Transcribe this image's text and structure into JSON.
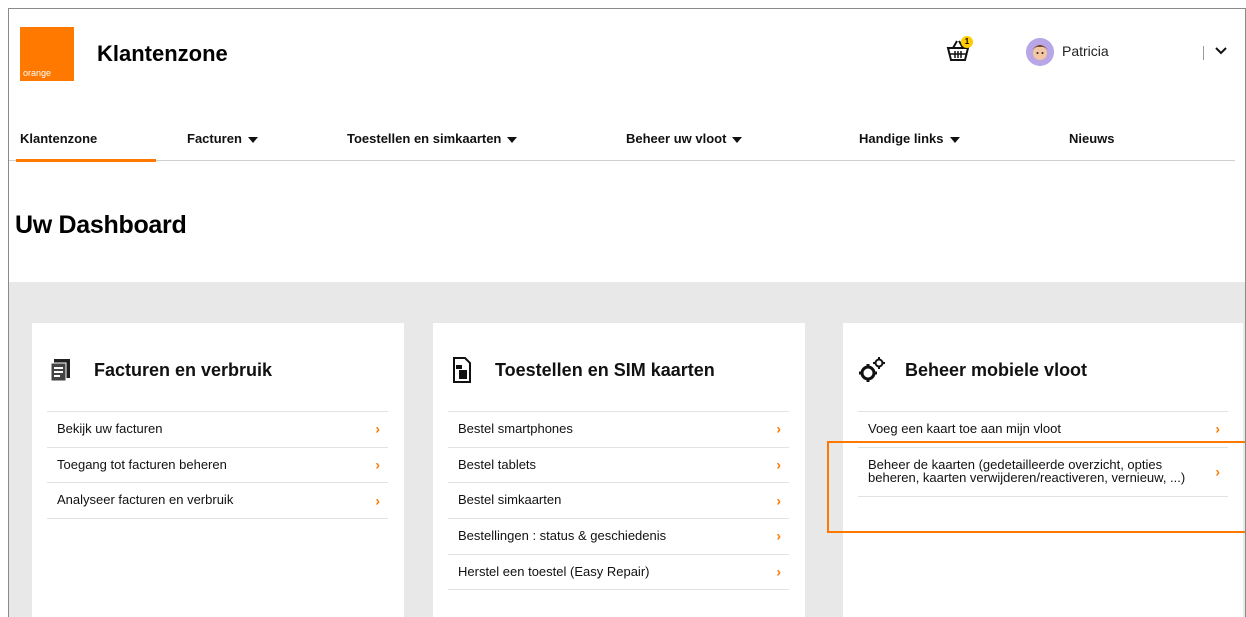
{
  "header": {
    "logo_text": "orange",
    "app_title": "Klantenzone",
    "cart_badge": "1",
    "user_name": "Patricia"
  },
  "nav": {
    "items": [
      {
        "label": "Klantenzone",
        "dropdown": false
      },
      {
        "label": "Facturen",
        "dropdown": true
      },
      {
        "label": "Toestellen en simkaarten",
        "dropdown": true
      },
      {
        "label": "Beheer uw vloot",
        "dropdown": true
      },
      {
        "label": "Handige links",
        "dropdown": true
      },
      {
        "label": "Nieuws",
        "dropdown": false
      }
    ],
    "active": "Klantenzone"
  },
  "page_title": "Uw Dashboard",
  "cards": [
    {
      "title": "Facturen en verbruik",
      "icon": "invoice-icon",
      "items": [
        "Bekijk uw facturen",
        "Toegang tot facturen beheren",
        "Analyseer facturen en verbruik"
      ]
    },
    {
      "title": "Toestellen en SIM kaarten",
      "icon": "sim-card-icon",
      "items": [
        "Bestel smartphones",
        "Bestel tablets",
        "Bestel simkaarten",
        "Bestellingen : status & geschiedenis",
        "Herstel een toestel (Easy Repair)"
      ]
    },
    {
      "title": "Beheer mobiele vloot",
      "icon": "gears-icon",
      "items": [
        "Voeg een kaart toe aan mijn vloot",
        "Beheer de kaarten (gedetailleerde overzicht, opties beheren, kaarten verwijderen/reactiveren, vernieuw, ...)"
      ]
    }
  ],
  "colors": {
    "accent": "#ff7900",
    "badge": "#ffcc00",
    "background_area": "#e8e8e8"
  }
}
